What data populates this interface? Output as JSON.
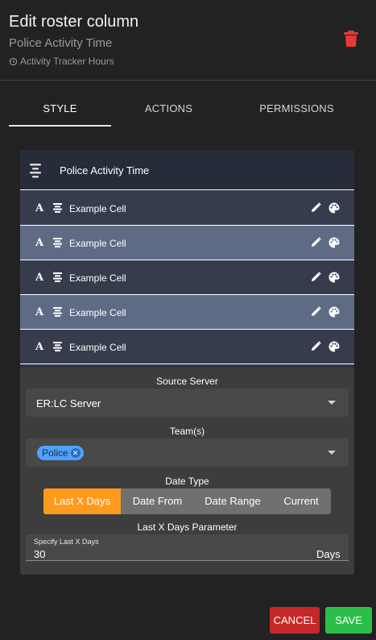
{
  "dialog": {
    "title": "Edit roster column",
    "subtitle": "Police Activity Time",
    "tracker_label": "Activity Tracker Hours"
  },
  "tabs": [
    {
      "label": "STYLE",
      "active": true
    },
    {
      "label": "ACTIONS",
      "active": false
    },
    {
      "label": "PERMISSIONS",
      "active": false
    }
  ],
  "preview": {
    "header_title": "Police Activity Time",
    "rows": [
      {
        "text": "Example Cell"
      },
      {
        "text": "Example Cell"
      },
      {
        "text": "Example Cell"
      },
      {
        "text": "Example Cell"
      },
      {
        "text": "Example Cell"
      }
    ]
  },
  "form": {
    "source_server": {
      "label": "Source Server",
      "value": "ER:LC Server"
    },
    "teams": {
      "label": "Team(s)",
      "chips": [
        "Police"
      ]
    },
    "date_type": {
      "label": "Date Type",
      "options": [
        "Last X Days",
        "Date From",
        "Date Range",
        "Current"
      ],
      "selected": "Last X Days"
    },
    "parameter": {
      "section_label": "Last X Days Parameter",
      "field_label": "Specify Last X Days",
      "value": "30",
      "unit": "Days"
    }
  },
  "buttons": {
    "cancel": "CANCEL",
    "save": "SAVE"
  },
  "colors": {
    "background": "#222222",
    "preview_header": "#262c39",
    "row_dark": "#363c4c",
    "row_light": "#5f6b85",
    "form_panel": "#3d3d3d",
    "chip": "#4da3ff",
    "segment_active": "#ff9a1f",
    "segment_inactive": "#707070",
    "cancel": "#c62828",
    "save": "#2bbf4a",
    "trash": "#e53935"
  },
  "icons": [
    "history-icon",
    "trash-icon",
    "align-center-icon",
    "font-icon",
    "pencil-icon",
    "palette-icon",
    "dropdown-caret-icon",
    "chip-remove-icon"
  ]
}
